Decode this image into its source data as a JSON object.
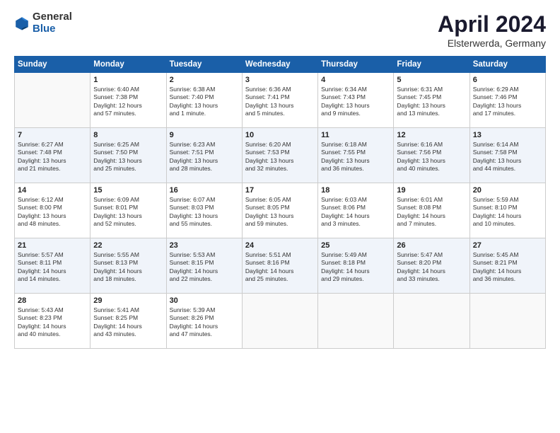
{
  "logo": {
    "general": "General",
    "blue": "Blue"
  },
  "title": "April 2024",
  "subtitle": "Elsterwerda, Germany",
  "headers": [
    "Sunday",
    "Monday",
    "Tuesday",
    "Wednesday",
    "Thursday",
    "Friday",
    "Saturday"
  ],
  "weeks": [
    [
      {
        "day": "",
        "info": ""
      },
      {
        "day": "1",
        "info": "Sunrise: 6:40 AM\nSunset: 7:38 PM\nDaylight: 12 hours\nand 57 minutes."
      },
      {
        "day": "2",
        "info": "Sunrise: 6:38 AM\nSunset: 7:40 PM\nDaylight: 13 hours\nand 1 minute."
      },
      {
        "day": "3",
        "info": "Sunrise: 6:36 AM\nSunset: 7:41 PM\nDaylight: 13 hours\nand 5 minutes."
      },
      {
        "day": "4",
        "info": "Sunrise: 6:34 AM\nSunset: 7:43 PM\nDaylight: 13 hours\nand 9 minutes."
      },
      {
        "day": "5",
        "info": "Sunrise: 6:31 AM\nSunset: 7:45 PM\nDaylight: 13 hours\nand 13 minutes."
      },
      {
        "day": "6",
        "info": "Sunrise: 6:29 AM\nSunset: 7:46 PM\nDaylight: 13 hours\nand 17 minutes."
      }
    ],
    [
      {
        "day": "7",
        "info": "Sunrise: 6:27 AM\nSunset: 7:48 PM\nDaylight: 13 hours\nand 21 minutes."
      },
      {
        "day": "8",
        "info": "Sunrise: 6:25 AM\nSunset: 7:50 PM\nDaylight: 13 hours\nand 25 minutes."
      },
      {
        "day": "9",
        "info": "Sunrise: 6:23 AM\nSunset: 7:51 PM\nDaylight: 13 hours\nand 28 minutes."
      },
      {
        "day": "10",
        "info": "Sunrise: 6:20 AM\nSunset: 7:53 PM\nDaylight: 13 hours\nand 32 minutes."
      },
      {
        "day": "11",
        "info": "Sunrise: 6:18 AM\nSunset: 7:55 PM\nDaylight: 13 hours\nand 36 minutes."
      },
      {
        "day": "12",
        "info": "Sunrise: 6:16 AM\nSunset: 7:56 PM\nDaylight: 13 hours\nand 40 minutes."
      },
      {
        "day": "13",
        "info": "Sunrise: 6:14 AM\nSunset: 7:58 PM\nDaylight: 13 hours\nand 44 minutes."
      }
    ],
    [
      {
        "day": "14",
        "info": "Sunrise: 6:12 AM\nSunset: 8:00 PM\nDaylight: 13 hours\nand 48 minutes."
      },
      {
        "day": "15",
        "info": "Sunrise: 6:09 AM\nSunset: 8:01 PM\nDaylight: 13 hours\nand 52 minutes."
      },
      {
        "day": "16",
        "info": "Sunrise: 6:07 AM\nSunset: 8:03 PM\nDaylight: 13 hours\nand 55 minutes."
      },
      {
        "day": "17",
        "info": "Sunrise: 6:05 AM\nSunset: 8:05 PM\nDaylight: 13 hours\nand 59 minutes."
      },
      {
        "day": "18",
        "info": "Sunrise: 6:03 AM\nSunset: 8:06 PM\nDaylight: 14 hours\nand 3 minutes."
      },
      {
        "day": "19",
        "info": "Sunrise: 6:01 AM\nSunset: 8:08 PM\nDaylight: 14 hours\nand 7 minutes."
      },
      {
        "day": "20",
        "info": "Sunrise: 5:59 AM\nSunset: 8:10 PM\nDaylight: 14 hours\nand 10 minutes."
      }
    ],
    [
      {
        "day": "21",
        "info": "Sunrise: 5:57 AM\nSunset: 8:11 PM\nDaylight: 14 hours\nand 14 minutes."
      },
      {
        "day": "22",
        "info": "Sunrise: 5:55 AM\nSunset: 8:13 PM\nDaylight: 14 hours\nand 18 minutes."
      },
      {
        "day": "23",
        "info": "Sunrise: 5:53 AM\nSunset: 8:15 PM\nDaylight: 14 hours\nand 22 minutes."
      },
      {
        "day": "24",
        "info": "Sunrise: 5:51 AM\nSunset: 8:16 PM\nDaylight: 14 hours\nand 25 minutes."
      },
      {
        "day": "25",
        "info": "Sunrise: 5:49 AM\nSunset: 8:18 PM\nDaylight: 14 hours\nand 29 minutes."
      },
      {
        "day": "26",
        "info": "Sunrise: 5:47 AM\nSunset: 8:20 PM\nDaylight: 14 hours\nand 33 minutes."
      },
      {
        "day": "27",
        "info": "Sunrise: 5:45 AM\nSunset: 8:21 PM\nDaylight: 14 hours\nand 36 minutes."
      }
    ],
    [
      {
        "day": "28",
        "info": "Sunrise: 5:43 AM\nSunset: 8:23 PM\nDaylight: 14 hours\nand 40 minutes."
      },
      {
        "day": "29",
        "info": "Sunrise: 5:41 AM\nSunset: 8:25 PM\nDaylight: 14 hours\nand 43 minutes."
      },
      {
        "day": "30",
        "info": "Sunrise: 5:39 AM\nSunset: 8:26 PM\nDaylight: 14 hours\nand 47 minutes."
      },
      {
        "day": "",
        "info": ""
      },
      {
        "day": "",
        "info": ""
      },
      {
        "day": "",
        "info": ""
      },
      {
        "day": "",
        "info": ""
      }
    ]
  ]
}
